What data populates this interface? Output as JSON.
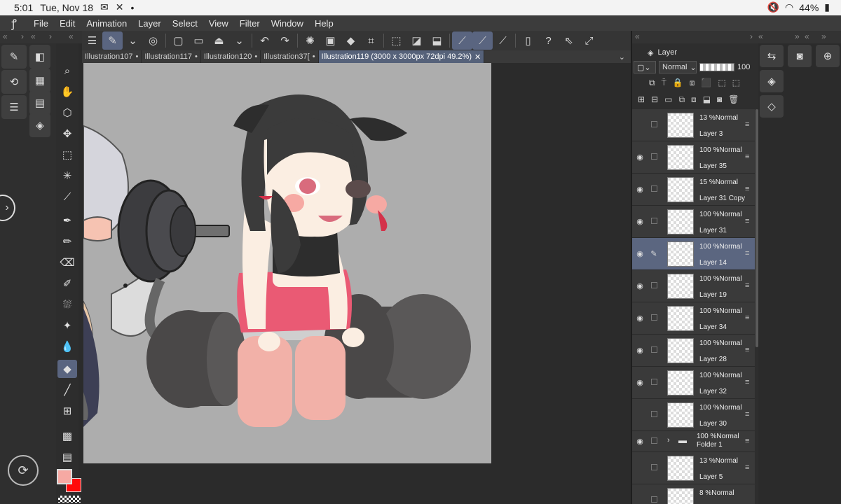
{
  "status": {
    "time": "5:01",
    "date": "Tue, Nov 18",
    "battery": "44%"
  },
  "menu": {
    "items": [
      "File",
      "Edit",
      "Animation",
      "Layer",
      "Select",
      "View",
      "Filter",
      "Window",
      "Help"
    ]
  },
  "tabs": [
    {
      "label": "Illustration107",
      "active": false
    },
    {
      "label": "Illustration117",
      "active": false
    },
    {
      "label": "Illustration120",
      "active": false
    },
    {
      "label": "Illustration37[",
      "active": false
    },
    {
      "label": "Illustration119 (3000 x 3000px 72dpi 49.2%)",
      "active": true
    }
  ],
  "layer_panel": {
    "title": "Layer",
    "blend_mode": "Normal",
    "opacity": "100",
    "layers": [
      {
        "blend": "13 %Normal",
        "name": "Layer 3",
        "visible": false,
        "selected": false
      },
      {
        "blend": "100 %Normal",
        "name": "Layer 35",
        "visible": true,
        "selected": false
      },
      {
        "blend": "15 %Normal",
        "name": "Layer 31 Copy",
        "visible": true,
        "selected": false
      },
      {
        "blend": "100 %Normal",
        "name": "Layer 31",
        "visible": true,
        "selected": false
      },
      {
        "blend": "100 %Normal",
        "name": "Layer 14",
        "visible": true,
        "selected": true
      },
      {
        "blend": "100 %Normal",
        "name": "Layer 19",
        "visible": true,
        "selected": false
      },
      {
        "blend": "100 %Normal",
        "name": "Layer 34",
        "visible": true,
        "selected": false
      },
      {
        "blend": "100 %Normal",
        "name": "Layer 28",
        "visible": true,
        "selected": false
      },
      {
        "blend": "100 %Normal",
        "name": "Layer 32",
        "visible": true,
        "selected": false
      },
      {
        "blend": "100 %Normal",
        "name": "Layer 30",
        "visible": false,
        "selected": false
      },
      {
        "blend": "100 %Normal",
        "name": "Folder 1",
        "visible": true,
        "selected": false,
        "folder": true
      },
      {
        "blend": "13 %Normal",
        "name": "Layer 5",
        "visible": false,
        "selected": false
      },
      {
        "blend": "8 %Normal",
        "name": "",
        "visible": false,
        "selected": false
      }
    ]
  },
  "colors": {
    "main": "#f6a9a3",
    "sub": "#ff0a0a",
    "accent": "#5b6680"
  }
}
